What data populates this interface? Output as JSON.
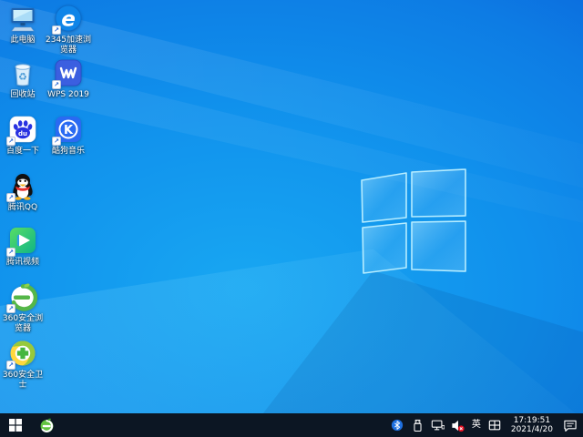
{
  "wallpaper": {
    "style": "windows10-default-light-blue",
    "base_color": "#0f86e8",
    "corner_dark_color": "#0a4ed0",
    "bottom_bright_color": "#18a7f2",
    "logo_edge_color": "#b5ecff"
  },
  "desktop_icons": [
    {
      "name": "this-pc",
      "label": "此电脑",
      "has_shortcut_arrow": false
    },
    {
      "name": "2345-browser",
      "label": "2345加速浏览器",
      "has_shortcut_arrow": true
    },
    {
      "name": "recycle-bin",
      "label": "回收站",
      "has_shortcut_arrow": false
    },
    {
      "name": "wps-2019",
      "label": "WPS 2019",
      "has_shortcut_arrow": true
    },
    {
      "name": "baidu-search",
      "label": "百度一下",
      "has_shortcut_arrow": true
    },
    {
      "name": "kugou-music",
      "label": "酷狗音乐",
      "has_shortcut_arrow": true
    },
    {
      "name": "tencent-qq",
      "label": "腾讯QQ",
      "has_shortcut_arrow": true
    },
    {
      "name": "tencent-video",
      "label": "腾讯视频",
      "has_shortcut_arrow": true
    },
    {
      "name": "360-browser",
      "label": "360安全浏览器",
      "has_shortcut_arrow": true
    },
    {
      "name": "360-safe-guard",
      "label": "360安全卫士",
      "has_shortcut_arrow": true
    }
  ],
  "shortcut_arrow_glyph": "↗",
  "taskbar": {
    "background_color": "#0c1623",
    "buttons": [
      {
        "name": "start-button",
        "icon": "windows-logo-icon"
      },
      {
        "name": "360-browser-taskbar-button",
        "icon": "360-browser-icon"
      }
    ],
    "tray": {
      "icons": [
        "bluetooth-icon",
        "usb-device-icon",
        "network-icon",
        "volume-muted-icon",
        "ime-indicator",
        "keyboard-layout-icon",
        "action-center-icon"
      ],
      "ime_label": "英",
      "clock": {
        "time": "17:19:51",
        "date": "2021/4/20"
      }
    }
  },
  "icon_colors": {
    "qq_scarf": "#e8302e",
    "wps_blue": "#3b5fe0",
    "baidu_paw_blue": "#2932e1",
    "kugou_blue": "#2a6af2",
    "tencent_video_green": "#3ecb5a",
    "360_green": "#55b748",
    "360_safe_yellow": "#ffd83d",
    "volume_mute_red": "#e81123",
    "bluetooth_blue": "#1f70e0"
  }
}
